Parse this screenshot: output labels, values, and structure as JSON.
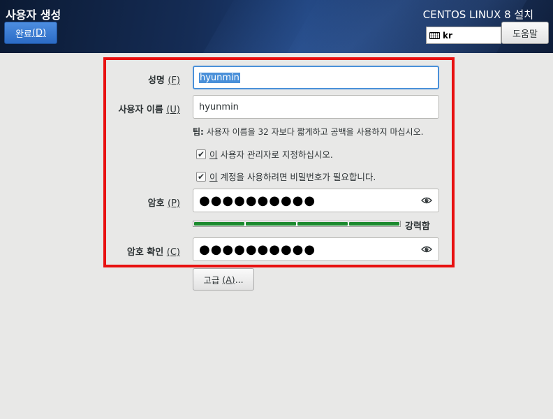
{
  "header": {
    "title": "사용자 생성",
    "done_label": "완료",
    "done_mnemonic": "(D)",
    "install_title": "CENTOS LINUX 8 설치",
    "keyboard_layout": "kr",
    "help_label": "도움말"
  },
  "form": {
    "fullname": {
      "label": "성명",
      "mnemonic": "(F)",
      "value": "hyunmin"
    },
    "username": {
      "label": "사용자 이름",
      "mnemonic": "(U)",
      "value": "hyunmin"
    },
    "tip": {
      "prefix": "팁:",
      "text": "사용자 이름을 32 자보다 짧게하고 공백을 사용하지 마십시오."
    },
    "admin_check": {
      "mnemonic": "이",
      "text": " 사용자 관리자로 지정하십시오.",
      "checked": true
    },
    "password_required_check": {
      "mnemonic": "이",
      "text": " 계정을 사용하려면 비밀번호가 필요합니다.",
      "checked": true
    },
    "password": {
      "label": "암호",
      "mnemonic": "(P)",
      "masked": "●●●●●●●●●●"
    },
    "strength": {
      "label": "강력함",
      "level": 1.0,
      "segments": 4
    },
    "confirm": {
      "label": "암호 확인",
      "mnemonic": "(C)",
      "masked": "●●●●●●●●●●"
    },
    "advanced": {
      "label": "고급",
      "mnemonic": "(A)",
      "suffix": "..."
    }
  },
  "colors": {
    "accent": "#4a90d9",
    "highlight_frame": "#e81010",
    "strength_bar": "#1b8a2e"
  }
}
